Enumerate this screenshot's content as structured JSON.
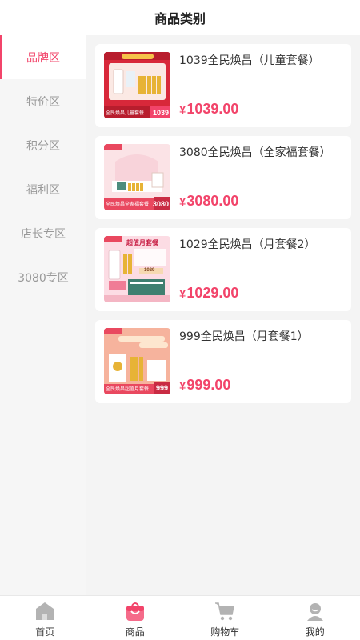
{
  "header": {
    "title": "商品类别"
  },
  "sidebar": {
    "items": [
      {
        "label": "品牌区",
        "active": true
      },
      {
        "label": "特价区",
        "active": false
      },
      {
        "label": "积分区",
        "active": false
      },
      {
        "label": "福利区",
        "active": false
      },
      {
        "label": "店长专区",
        "active": false
      },
      {
        "label": "3080专区",
        "active": false
      }
    ]
  },
  "products": [
    {
      "name": "1039全民焕昌（儿童套餐）",
      "currency": "¥",
      "price": "1039.00",
      "thumb_badge": "1039",
      "thumb_caption": "全民焕昌儿童套餐"
    },
    {
      "name": "3080全民焕昌（全家福套餐）",
      "currency": "¥",
      "price": "3080.00",
      "thumb_badge": "3080",
      "thumb_caption": "全民焕昌全家福套餐"
    },
    {
      "name": "1029全民焕昌（月套餐2）",
      "currency": "¥",
      "price": "1029.00",
      "thumb_badge": "1029",
      "thumb_caption": "超值月套餐"
    },
    {
      "name": "999全民焕昌（月套餐1）",
      "currency": "¥",
      "price": "999.00",
      "thumb_badge": "999",
      "thumb_caption": "全民焕昌超值月套餐"
    }
  ],
  "tabbar": {
    "items": [
      {
        "label": "首页",
        "icon": "home-icon",
        "active": false
      },
      {
        "label": "商品",
        "icon": "bag-icon",
        "active": true
      },
      {
        "label": "购物车",
        "icon": "cart-icon",
        "active": false
      },
      {
        "label": "我的",
        "icon": "user-icon",
        "active": false
      }
    ]
  },
  "colors": {
    "accent": "#f2446a",
    "inactive_text": "#999999",
    "content_bg": "#f4f4f4",
    "sidebar_bg": "#f6f6f6"
  }
}
